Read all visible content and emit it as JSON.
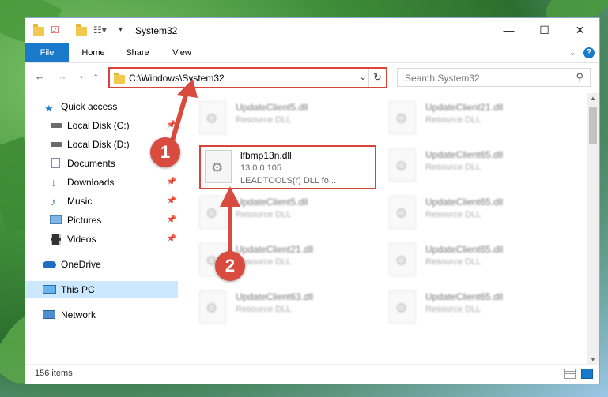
{
  "window": {
    "title": "System32",
    "minimize_glyph": "—",
    "maximize_glyph": "☐",
    "close_glyph": "✕"
  },
  "ribbon": {
    "tabs": [
      "File",
      "Home",
      "Share",
      "View"
    ],
    "expand_glyph": "⌄",
    "help_glyph": "?"
  },
  "address": {
    "path": "C:\\Windows\\System32",
    "dropdown_glyph": "⌄",
    "refresh_glyph": "↻",
    "back_glyph": "←",
    "forward_glyph": "→",
    "recent_glyph": "⌄",
    "up_glyph": "↑"
  },
  "search": {
    "placeholder": "Search System32",
    "icon": "search-icon",
    "glyph": "⚲"
  },
  "nav": {
    "pin_glyph": "📌",
    "items": [
      {
        "label": "Quick access",
        "icon": "star-icon",
        "pinned": false
      },
      {
        "label": "Local Disk (C:)",
        "icon": "drive-icon",
        "pinned": true
      },
      {
        "label": "Local Disk (D:)",
        "icon": "drive-icon",
        "pinned": false
      },
      {
        "label": "Documents",
        "icon": "document-icon",
        "pinned": true
      },
      {
        "label": "Downloads",
        "icon": "download-icon",
        "pinned": true
      },
      {
        "label": "Music",
        "icon": "music-icon",
        "pinned": true
      },
      {
        "label": "Pictures",
        "icon": "pictures-icon",
        "pinned": true
      },
      {
        "label": "Videos",
        "icon": "video-icon",
        "pinned": true
      },
      {
        "label": "OneDrive",
        "icon": "cloud-icon",
        "pinned": false
      },
      {
        "label": "This PC",
        "icon": "monitor-icon",
        "pinned": false,
        "selected": true
      },
      {
        "label": "Network",
        "icon": "network-icon",
        "pinned": false
      }
    ]
  },
  "files": [
    {
      "name": "UpdateClient5.dll",
      "type": "Resource DLL"
    },
    {
      "name": "UpdateClient21.dll",
      "type": "Resource DLL"
    },
    {
      "name": "lfbmp13n.dll",
      "version": "13.0.0.105",
      "description": "LEADTOOLS(r) DLL fo...",
      "highlighted": true
    },
    {
      "name": "UpdateClient65.dll",
      "type": "Resource DLL"
    },
    {
      "name": "UpdateClient5.dll",
      "type": "Resource DLL"
    },
    {
      "name": "UpdateClient65.dll",
      "type": "Resource DLL"
    },
    {
      "name": "UpdateClient21.dll",
      "type": "Resource DLL"
    },
    {
      "name": "UpdateClient65.dll",
      "type": "Resource DLL"
    },
    {
      "name": "UpdateClient63.dll",
      "type": "Resource DLL"
    },
    {
      "name": "UpdateClient65.dll",
      "type": "Resource DLL"
    }
  ],
  "status": {
    "item_count": "156 items"
  },
  "annotations": {
    "step1": "1",
    "step2": "2"
  },
  "colors": {
    "accent": "#1979ca",
    "highlight": "#d9443a"
  }
}
